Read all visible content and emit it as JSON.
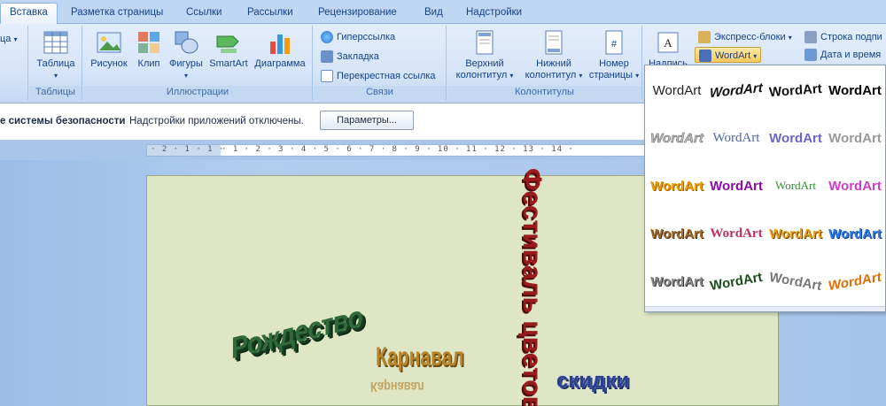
{
  "tabs": [
    {
      "label": "Вставка",
      "active": true
    },
    {
      "label": "Разметка страницы"
    },
    {
      "label": "Ссылки"
    },
    {
      "label": "Рассылки"
    },
    {
      "label": "Рецензирование"
    },
    {
      "label": "Вид"
    },
    {
      "label": "Надстройки"
    }
  ],
  "ribbon": {
    "groups": {
      "tables": "Таблицы",
      "illustrations": "Иллюстрации",
      "links": "Связи",
      "headers": "Колонтитулы"
    },
    "table_btn": "Таблица",
    "picture_btn": "Рисунок",
    "clip_btn": "Клип",
    "shapes_btn": "Фигуры",
    "smartart_btn": "SmartArt",
    "chart_btn": "Диаграмма",
    "hyperlink": "Гиперссылка",
    "bookmark": "Закладка",
    "crossref": "Перекрестная ссылка",
    "header_btn_l1": "Верхний",
    "header_btn_l2": "колонтитул",
    "footer_btn_l1": "Нижний",
    "footer_btn_l2": "колонтитул",
    "pagenum_l1": "Номер",
    "pagenum_l2": "страницы",
    "textbox_partial": "Надпись",
    "quickparts": "Экспресс-блоки",
    "wordart": "WordArt",
    "signature_line": "Строка подпи",
    "datetime": "Дата и время"
  },
  "msgbar": {
    "security": "е системы безопасности",
    "text": "Надстройки приложений отключены.",
    "button": "Параметры..."
  },
  "ruler": {
    "left": "· 2 · 1 · 1 ·",
    "right": "· 1 · 2 · 3 · 4 · 5 · 6 · 7 · 8 · 9 · 10 · 11 · 12 · 13 · 14 ·"
  },
  "document": {
    "wa1": "Рождество",
    "wa2": "Карнавал",
    "wa3": "Фестиваль цветов",
    "wa4": "скидки"
  },
  "gallery": {
    "sample": "WordArt",
    "rows": 5,
    "cols": 4
  },
  "colors": {
    "accent": "#15428b",
    "ribbon_bg": "#d6e5f8",
    "page": "#dfe6c6"
  }
}
